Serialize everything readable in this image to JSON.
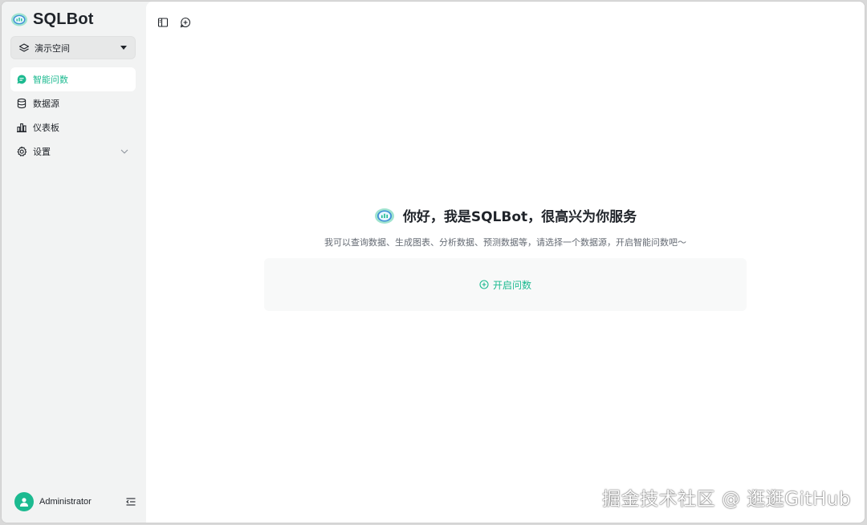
{
  "app": {
    "name": "SQLBot"
  },
  "workspace": {
    "label": "演示空间"
  },
  "nav": {
    "items": [
      {
        "label": "智能问数",
        "icon": "chat-icon",
        "active": true
      },
      {
        "label": "数据源",
        "icon": "database-icon"
      },
      {
        "label": "仪表板",
        "icon": "bar-chart-icon"
      },
      {
        "label": "设置",
        "icon": "gear-icon",
        "expandable": true
      }
    ]
  },
  "user": {
    "name": "Administrator"
  },
  "main": {
    "welcome_title": "你好，我是SQLBot，很高兴为你服务",
    "welcome_subtitle": "我可以查询数据、生成图表、分析数据、预测数据等，请选择一个数据源，开启智能问数吧～",
    "start_button": "开启问数"
  },
  "watermark": "掘金技术社区 @ 逛逛GitHub",
  "colors": {
    "accent": "#1cba90",
    "sidebar_bg": "#f2f3f3",
    "main_bg": "#ffffff",
    "text": "#1f2329"
  }
}
